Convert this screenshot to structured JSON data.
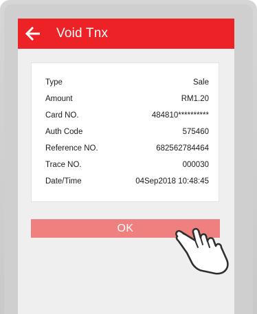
{
  "header": {
    "title": "Void Tnx",
    "back_icon": "back-arrow-icon"
  },
  "details": [
    {
      "label": "Type",
      "value": "Sale"
    },
    {
      "label": "Amount",
      "value": "RM1.20"
    },
    {
      "label": "Card NO.",
      "value": "484810**********"
    },
    {
      "label": "Auth Code",
      "value": "575460"
    },
    {
      "label": "Reference NO.",
      "value": "682562784464"
    },
    {
      "label": "Trace NO.",
      "value": "000030"
    },
    {
      "label": "Date/Time",
      "value": "04Sep2018 10:48:45"
    }
  ],
  "ok_button": {
    "label": "OK"
  },
  "colors": {
    "header": "#ec2227",
    "button": "#f08080",
    "screen_bg": "#efefef",
    "device_frame": "#cfcfcf"
  },
  "icons": {
    "tap_hand": "tap-hand-icon"
  }
}
